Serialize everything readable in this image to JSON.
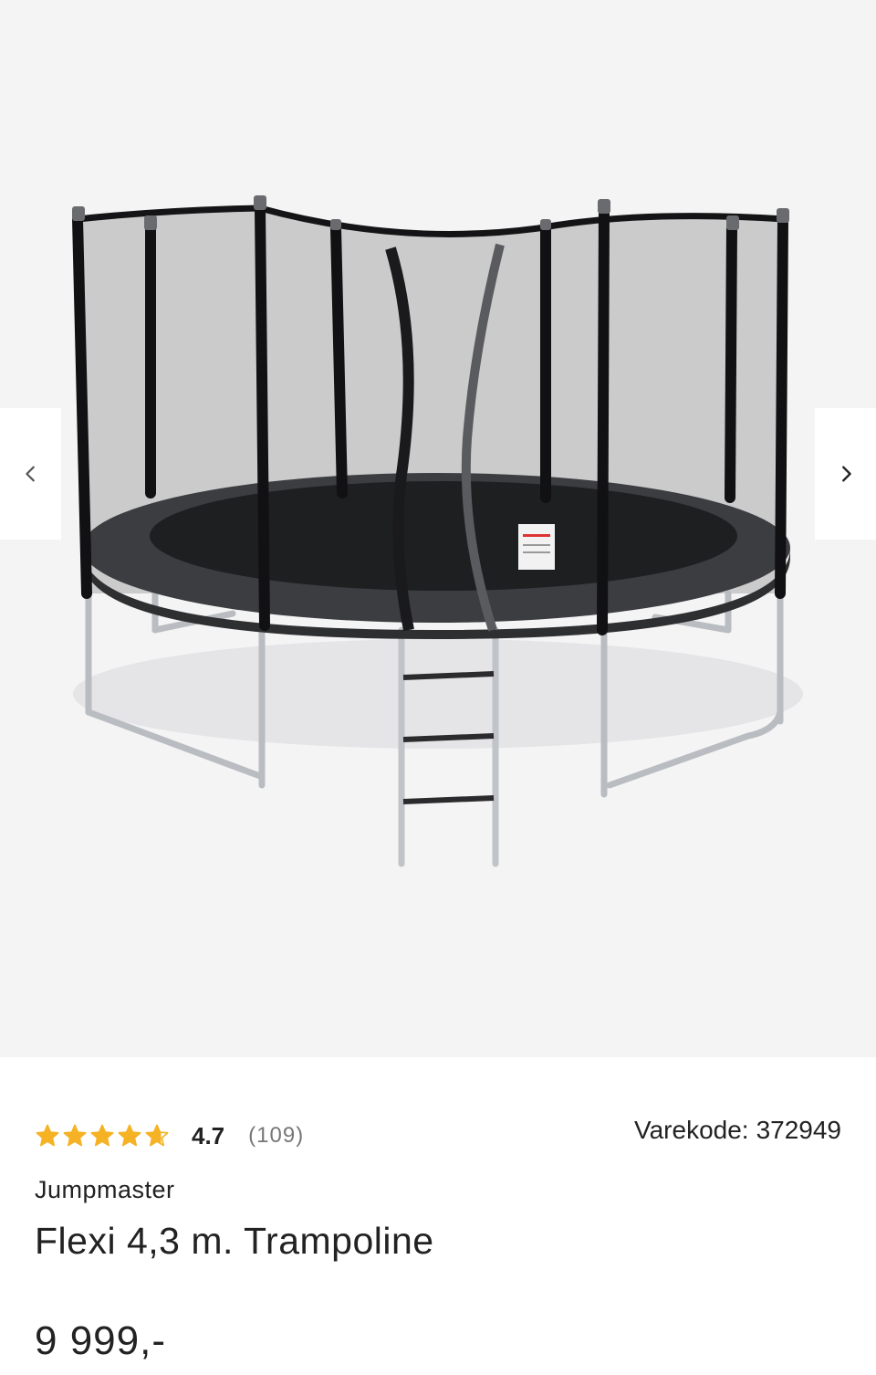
{
  "gallery": {
    "prev_icon": "chevron-left-icon",
    "next_icon": "chevron-right-icon",
    "image_subject": "trampoline-with-safety-net"
  },
  "product": {
    "rating": {
      "value": "4.7",
      "stars_filled": 4.7,
      "stars_total": 5,
      "count": "(109)",
      "star_color": "#f5b224"
    },
    "sku_label": "Varekode:",
    "sku_value": "372949",
    "brand": "Jumpmaster",
    "title": "Flexi 4,3 m. Trampoline",
    "price": "9 999,-"
  }
}
